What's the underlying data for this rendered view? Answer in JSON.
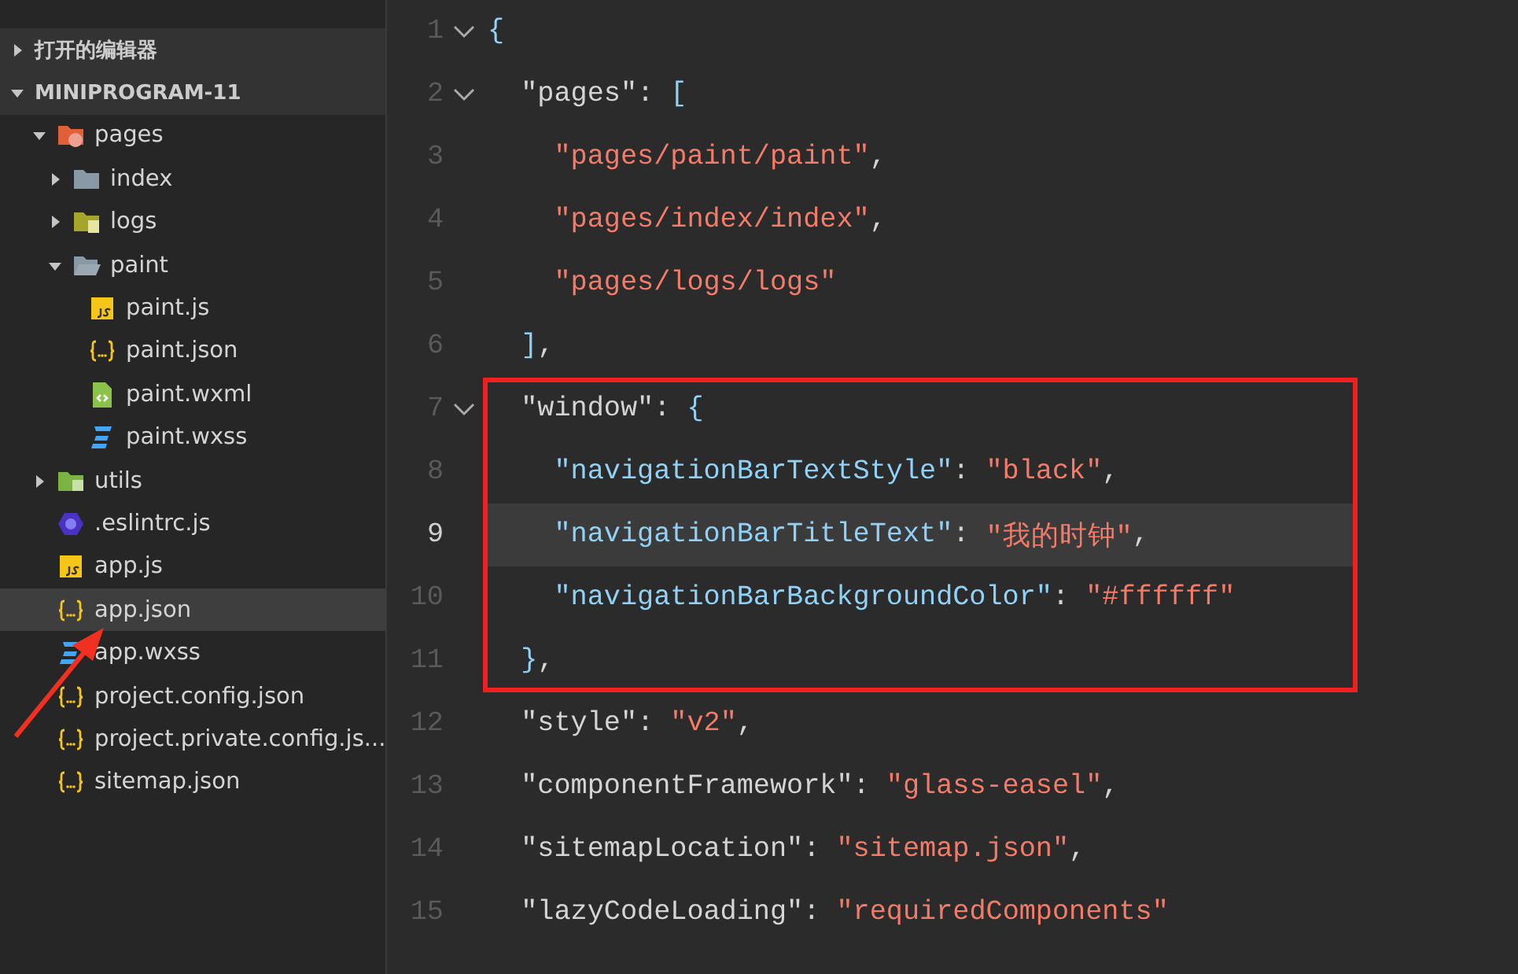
{
  "sidebar": {
    "sections": [
      {
        "label": "打开的编辑器",
        "expanded": false
      },
      {
        "label": "MINIPROGRAM-11",
        "expanded": true,
        "children": [
          {
            "name": "pages",
            "kind": "pages-folder",
            "expanded": true,
            "selected": false,
            "children": [
              {
                "name": "index",
                "kind": "folder",
                "expanded": false,
                "selected": false
              },
              {
                "name": "logs",
                "kind": "logs-folder",
                "expanded": false,
                "selected": false
              },
              {
                "name": "paint",
                "kind": "folder",
                "expanded": true,
                "selected": false,
                "children": [
                  {
                    "name": "paint.js",
                    "kind": "js",
                    "selected": false
                  },
                  {
                    "name": "paint.json",
                    "kind": "json",
                    "selected": false
                  },
                  {
                    "name": "paint.wxml",
                    "kind": "wxml",
                    "selected": false
                  },
                  {
                    "name": "paint.wxss",
                    "kind": "wxss",
                    "selected": false
                  }
                ]
              }
            ]
          },
          {
            "name": "utils",
            "kind": "utils-folder",
            "expanded": false,
            "selected": false
          },
          {
            "name": ".eslintrc.js",
            "kind": "eslint",
            "selected": false
          },
          {
            "name": "app.js",
            "kind": "js",
            "selected": false
          },
          {
            "name": "app.json",
            "kind": "json",
            "selected": true
          },
          {
            "name": "app.wxss",
            "kind": "wxss",
            "selected": false
          },
          {
            "name": "project.config.json",
            "kind": "json",
            "selected": false
          },
          {
            "name": "project.private.config.js...",
            "kind": "json",
            "selected": false
          },
          {
            "name": "sitemap.json",
            "kind": "json",
            "selected": false
          }
        ]
      }
    ]
  },
  "editor": {
    "lines": [
      {
        "number": "1",
        "foldable": true,
        "current": false,
        "boxed": false,
        "tokens": [
          {
            "t": "{",
            "kind": "bracket"
          }
        ]
      },
      {
        "number": "2",
        "foldable": true,
        "current": false,
        "boxed": false,
        "tokens": [
          {
            "t": "  \"pages\"",
            "kind": "key"
          },
          {
            "t": ": ",
            "kind": "punct"
          },
          {
            "t": "[",
            "kind": "bracket"
          }
        ]
      },
      {
        "number": "3",
        "foldable": false,
        "current": false,
        "boxed": false,
        "tokens": [
          {
            "t": "    \"pages/paint/paint\"",
            "kind": "string"
          },
          {
            "t": ",",
            "kind": "punct"
          }
        ]
      },
      {
        "number": "4",
        "foldable": false,
        "current": false,
        "boxed": false,
        "tokens": [
          {
            "t": "    \"pages/index/index\"",
            "kind": "string"
          },
          {
            "t": ",",
            "kind": "punct"
          }
        ]
      },
      {
        "number": "5",
        "foldable": false,
        "current": false,
        "boxed": false,
        "tokens": [
          {
            "t": "    \"pages/logs/logs\"",
            "kind": "string"
          }
        ]
      },
      {
        "number": "6",
        "foldable": false,
        "current": false,
        "boxed": false,
        "tokens": [
          {
            "t": "  ]",
            "kind": "bracket"
          },
          {
            "t": ",",
            "kind": "punct"
          }
        ]
      },
      {
        "number": "7",
        "foldable": true,
        "current": false,
        "boxed": true,
        "tokens": [
          {
            "t": "  \"window\"",
            "kind": "key"
          },
          {
            "t": ": ",
            "kind": "punct"
          },
          {
            "t": "{",
            "kind": "bracket"
          }
        ]
      },
      {
        "number": "8",
        "foldable": false,
        "current": false,
        "boxed": true,
        "tokens": [
          {
            "t": "    \"navigationBarTextStyle\"",
            "kind": "subkey"
          },
          {
            "t": ": ",
            "kind": "punct"
          },
          {
            "t": "\"black\"",
            "kind": "string"
          },
          {
            "t": ",",
            "kind": "punct"
          }
        ]
      },
      {
        "number": "9",
        "foldable": false,
        "current": true,
        "boxed": true,
        "tokens": [
          {
            "t": "    \"navigationBarTitleText\"",
            "kind": "subkey"
          },
          {
            "t": ": ",
            "kind": "punct"
          },
          {
            "t": "\"我的时钟\"",
            "kind": "string"
          },
          {
            "t": ",",
            "kind": "punct"
          }
        ]
      },
      {
        "number": "10",
        "foldable": false,
        "current": false,
        "boxed": true,
        "tokens": [
          {
            "t": "    \"navigationBarBackgroundColor\"",
            "kind": "subkey"
          },
          {
            "t": ": ",
            "kind": "punct"
          },
          {
            "t": "\"#ffffff\"",
            "kind": "string"
          }
        ]
      },
      {
        "number": "11",
        "foldable": false,
        "current": false,
        "boxed": true,
        "tokens": [
          {
            "t": "  }",
            "kind": "bracket"
          },
          {
            "t": ",",
            "kind": "punct"
          }
        ]
      },
      {
        "number": "12",
        "foldable": false,
        "current": false,
        "boxed": false,
        "tokens": [
          {
            "t": "  \"style\"",
            "kind": "key"
          },
          {
            "t": ": ",
            "kind": "punct"
          },
          {
            "t": "\"v2\"",
            "kind": "string"
          },
          {
            "t": ",",
            "kind": "punct"
          }
        ]
      },
      {
        "number": "13",
        "foldable": false,
        "current": false,
        "boxed": false,
        "tokens": [
          {
            "t": "  \"componentFramework\"",
            "kind": "key"
          },
          {
            "t": ": ",
            "kind": "punct"
          },
          {
            "t": "\"glass-easel\"",
            "kind": "string"
          },
          {
            "t": ",",
            "kind": "punct"
          }
        ]
      },
      {
        "number": "14",
        "foldable": false,
        "current": false,
        "boxed": false,
        "tokens": [
          {
            "t": "  \"sitemapLocation\"",
            "kind": "key"
          },
          {
            "t": ": ",
            "kind": "punct"
          },
          {
            "t": "\"sitemap.json\"",
            "kind": "string"
          },
          {
            "t": ",",
            "kind": "punct"
          }
        ]
      },
      {
        "number": "15",
        "foldable": false,
        "current": false,
        "boxed": false,
        "tokens": [
          {
            "t": "  \"lazyCodeLoading\"",
            "kind": "key"
          },
          {
            "t": ": ",
            "kind": "punct"
          },
          {
            "t": "\"requiredComponents\"",
            "kind": "string"
          }
        ]
      }
    ]
  }
}
